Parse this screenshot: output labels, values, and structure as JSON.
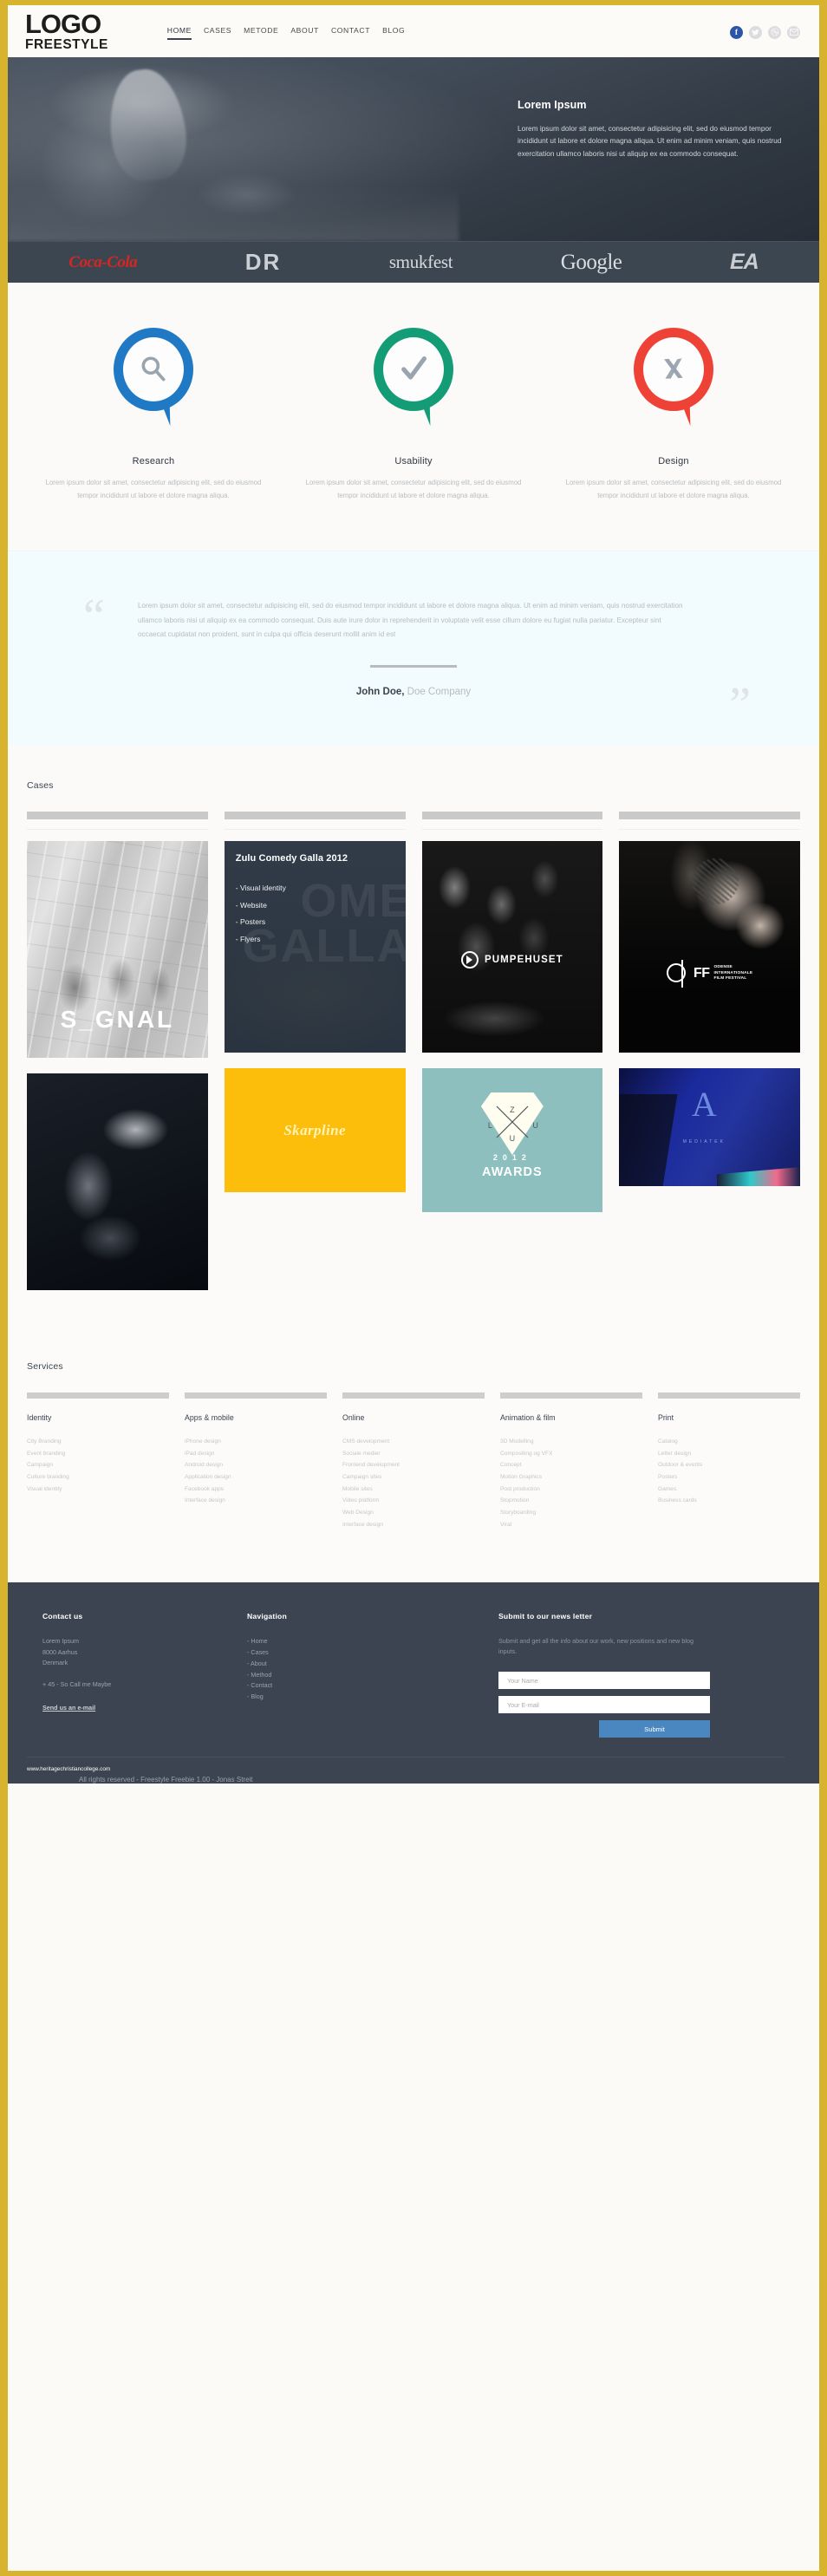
{
  "brand": {
    "logo_main": "LOGO",
    "logo_sub": "FREESTYLE"
  },
  "nav": {
    "items": [
      {
        "label": "HOME",
        "active": true
      },
      {
        "label": "CASES",
        "active": false
      },
      {
        "label": "METODE",
        "active": false
      },
      {
        "label": "ABOUT",
        "active": false
      },
      {
        "label": "CONTACT",
        "active": false
      },
      {
        "label": "BLOG",
        "active": false
      }
    ]
  },
  "socials": [
    {
      "name": "facebook-icon",
      "glyph": "f"
    },
    {
      "name": "twitter-icon",
      "glyph": ""
    },
    {
      "name": "dribbble-icon",
      "glyph": ""
    },
    {
      "name": "email-icon",
      "glyph": ""
    }
  ],
  "hero": {
    "title": "Lorem Ipsum",
    "body": "Lorem ipsum dolor sit amet, consectetur adipisicing elit, sed do eiusmod tempor incididunt ut labore et dolore magna aliqua. Ut enim ad minim veniam, quis nostrud exercitation ullamco laboris nisi ut aliquip ex ea commodo consequat."
  },
  "clients": [
    {
      "name": "Coca-Cola"
    },
    {
      "name": "DR"
    },
    {
      "name": "smukfest"
    },
    {
      "name": "Google"
    },
    {
      "name": "EA"
    }
  ],
  "features": [
    {
      "icon": "magnifier-icon",
      "color": "#2079C4",
      "title": "Research",
      "body": "Lorem ipsum dolor sit amet, consectetur adipisicing elit, sed do eiusmod tempor incididunt ut labore et dolore magna aliqua."
    },
    {
      "icon": "checkmark-icon",
      "color": "#139C76",
      "title": "Usability",
      "body": "Lorem ipsum dolor sit amet, consectetur adipisicing elit, sed do eiusmod tempor incididunt ut labore et dolore magna aliqua."
    },
    {
      "icon": "brush-pen-icon",
      "color": "#EE4236",
      "title": "Design",
      "body": "Lorem ipsum dolor sit amet, consectetur adipisicing elit, sed do eiusmod tempor incididunt ut labore et dolore magna aliqua."
    }
  ],
  "testimonial": {
    "quote": "Lorem ipsum dolor sit amet, consectetur adipisicing elit, sed do eiusmod tempor incididunt ut labore et dolore magna aliqua. Ut enim ad minim veniam, quis nostrud exercitation ullamco laboris nisi ut aliquip ex ea commodo consequat. Duis aute irure dolor in reprehenderit in voluptate velit esse cillum dolore eu fugiat nulla pariatur. Excepteur sint occaecat cupidatat non proident, sunt in culpa qui officia deserunt mollit anim id est",
    "author": "John Doe,",
    "company": " Doe Company",
    "open_quote": "“",
    "close_quote": "”"
  },
  "cases": {
    "section_title": "Cases",
    "items": [
      {
        "name": "signal",
        "label": "S_GNAL"
      },
      {
        "name": "zulu-comedy-galla",
        "title": "Zulu Comedy Galla 2012",
        "ghost": "OME GALLA",
        "bullets": [
          "- Visual identity",
          "- Website",
          "- Posters",
          "- Flyers"
        ]
      },
      {
        "name": "pumpehuset",
        "label": "PUMPEHUSET"
      },
      {
        "name": "odense-film-festival",
        "mark": "FF",
        "sub_line1": "ODENSE",
        "sub_line2": "INTERNATIONALE",
        "sub_line3": "FILM FESTIVAL"
      },
      {
        "name": "portrait",
        "label": ""
      },
      {
        "name": "skarpline",
        "label": "Skarpline"
      },
      {
        "name": "zulu-awards",
        "letters": [
          "Z",
          "L",
          "U",
          "U"
        ],
        "year_left": "20",
        "year_right": "12",
        "label": "AWARDS"
      },
      {
        "name": "mediatek",
        "letter": "A",
        "label": "MEDIATEK"
      }
    ]
  },
  "services": {
    "section_title": "Services",
    "columns": [
      {
        "title": "Identity",
        "items": [
          "City Branding",
          "Event branding",
          "Campaign",
          "Culture branding",
          "Visual identity"
        ]
      },
      {
        "title": "Apps & mobile",
        "items": [
          "iPhone design",
          "iPad design",
          "Android design",
          "Application design",
          "Facebook apps",
          "Interface design"
        ]
      },
      {
        "title": "Online",
        "items": [
          "CMS development",
          "Sociale medier",
          "Frontend development",
          "Campaign sites",
          "Mobile sites",
          "Video platform",
          "Web Design",
          "Interface design"
        ]
      },
      {
        "title": "Animation & film",
        "items": [
          "3D Modelling",
          "Compositing og VFX",
          "Concept",
          "Motion Graphics",
          "Post production",
          "Stopmotion",
          "Storyboarding",
          "Viral"
        ]
      },
      {
        "title": "Print",
        "items": [
          "Catalog",
          "Letter design",
          "Outdoor & events",
          "Posters",
          "Games",
          "Business cards"
        ]
      }
    ]
  },
  "footer": {
    "contact": {
      "heading": "Contact us",
      "line1": "Lorem Ipsum",
      "line2": "8000 Aarhus",
      "line3": "Denmark",
      "phone": "+ 45 - So Call me Maybe",
      "email_link": "Send us an e-mail"
    },
    "navigation": {
      "heading": "Navigation",
      "items": [
        "- Home",
        "- Cases",
        "- About",
        "- Method",
        "- Contact",
        "- Blog"
      ]
    },
    "newsletter": {
      "heading": "Submit to our news letter",
      "subtitle": "Submit and get all the info about our work, new positions and new blog inputs.",
      "name_placeholder": "Your Name",
      "name_value": "",
      "email_placeholder": "Your E-mail",
      "email_value": "",
      "submit_label": "Submit"
    },
    "bottom": {
      "url": "www.heritagechristiancollege.com",
      "copyright": "All rights reserved - Freestyle Freebie 1.00 - Jonas Streit"
    }
  },
  "colors": {
    "frame": "#D8B42E",
    "dark": "#3B4450",
    "accent_blue": "#4A87C0",
    "research": "#2079C4",
    "usability": "#139C76",
    "design": "#EE4236"
  }
}
